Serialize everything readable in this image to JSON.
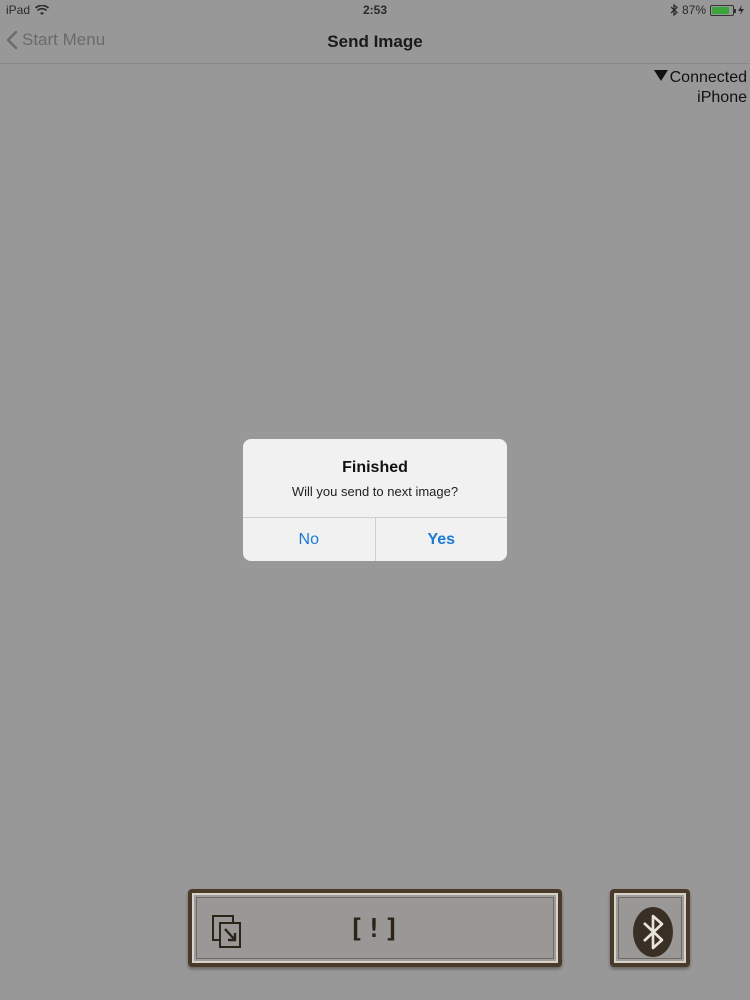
{
  "status_bar": {
    "device": "iPad",
    "time": "2:53",
    "battery_percent": "87%",
    "battery_level": 0.87,
    "icons": [
      "wifi-icon",
      "bluetooth-icon",
      "battery-icon",
      "charging-icon"
    ]
  },
  "nav": {
    "back_label": "Start Menu",
    "title": "Send Image"
  },
  "connection": {
    "status": "Connected",
    "device": "iPhone"
  },
  "alert": {
    "title": "Finished",
    "message": "Will you send to next image?",
    "no_label": "No",
    "yes_label": "Yes",
    "button_color": "#1c7ad6"
  },
  "toolbar": {
    "error_label": "[!]",
    "icons": [
      "export-icon",
      "bluetooth-icon"
    ]
  },
  "colors": {
    "background": "#999899",
    "button_border": "#4a3a2a",
    "battery": "#3aa53a"
  }
}
